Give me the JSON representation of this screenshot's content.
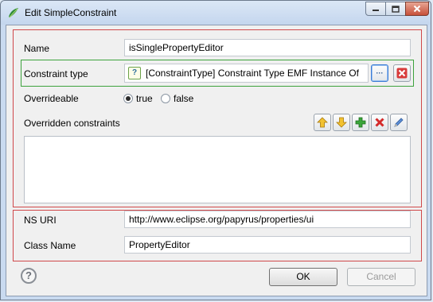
{
  "window": {
    "title": "Edit SimpleConstraint",
    "icons": {
      "app": "papyrus-leaf-icon",
      "minimize": "minimize-icon",
      "maximize": "maximize-icon",
      "close": "close-icon"
    }
  },
  "constraint": {
    "name_label": "Name",
    "name_value": "isSinglePropertyEditor",
    "type_label": "Constraint type",
    "type_value": "[ConstraintType] Constraint Type EMF Instance Of",
    "type_icon": "question-mark-icon",
    "overrideable_label": "Overrideable",
    "overrideable_options": [
      "true",
      "false"
    ],
    "overrideable_selected": "true",
    "overridden_label": "Overridden constraints",
    "overridden_items": []
  },
  "type_buttons": {
    "browse_label": "···",
    "delete_icon": "red-x-icon"
  },
  "list_toolbar": {
    "icons": [
      "move-up-icon",
      "move-down-icon",
      "add-icon",
      "delete-icon",
      "edit-icon"
    ]
  },
  "class_info": {
    "ns_uri_label": "NS URI",
    "ns_uri_value": "http://www.eclipse.org/papyrus/properties/ui",
    "class_name_label": "Class Name",
    "class_name_value": "PropertyEditor"
  },
  "footer": {
    "help_label": "?",
    "ok_label": "OK",
    "cancel_label": "Cancel"
  },
  "colors": {
    "group_border": "#d0484a",
    "type_border": "#3da33d",
    "focus_border": "#3a7bd5"
  }
}
